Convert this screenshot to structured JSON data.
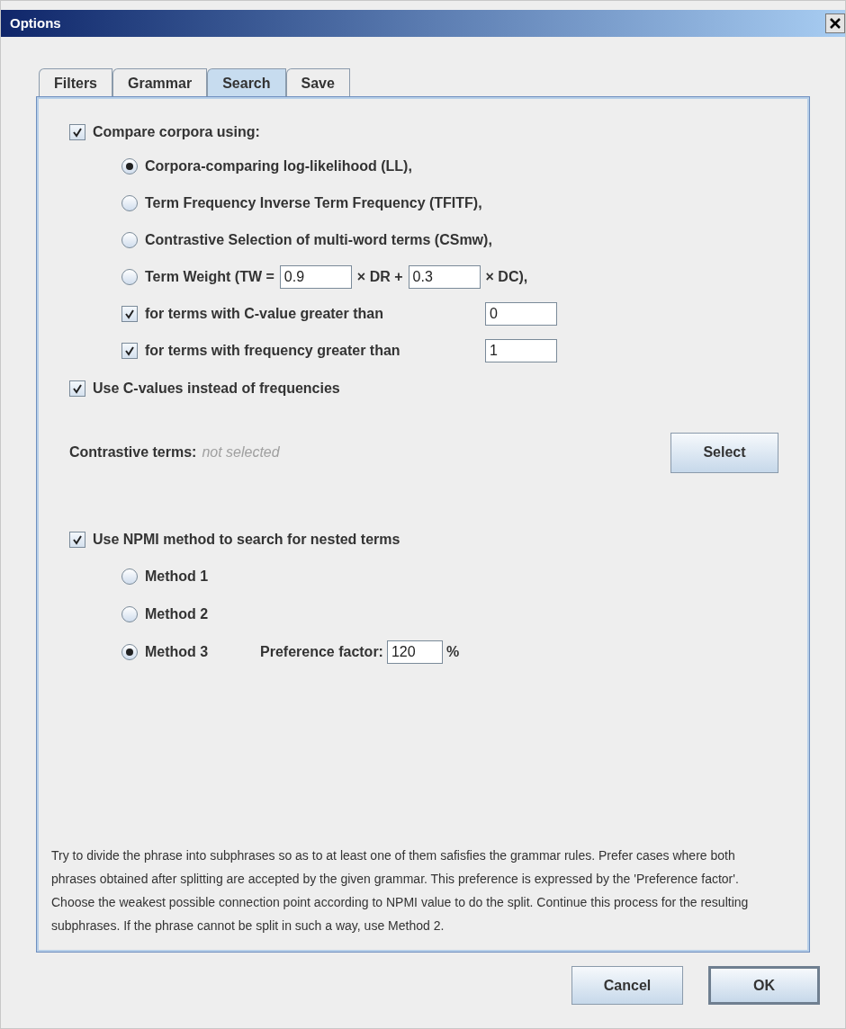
{
  "window": {
    "title": "Options"
  },
  "tabs": [
    {
      "label": "Filters",
      "selected": false
    },
    {
      "label": "Grammar",
      "selected": false
    },
    {
      "label": "Search",
      "selected": true
    },
    {
      "label": "Save",
      "selected": false
    }
  ],
  "compare_corpora": {
    "label": "Compare corpora using:",
    "checked": true,
    "methods": [
      {
        "kind": "plain",
        "label": "Corpora-comparing log-likelihood (LL),",
        "selected": true
      },
      {
        "kind": "plain",
        "label": "Term Frequency Inverse Term Frequency (TFITF),",
        "selected": false
      },
      {
        "kind": "plain",
        "label": "Contrastive Selection of multi-word terms (CSmw),",
        "selected": false
      },
      {
        "kind": "weight",
        "label": "Term Weight  (TW =",
        "dr_value": "0.9",
        "dr_label": "× DR +",
        "dc_value": "0.3",
        "dc_label": "× DC),",
        "selected": false
      }
    ],
    "thresholds": [
      {
        "label": "for terms with C-value greater than",
        "checked": true,
        "value": "0"
      },
      {
        "label": "for terms with frequency greater than",
        "checked": true,
        "value": "1"
      }
    ]
  },
  "use_c_values": {
    "label": "Use C-values instead of frequencies",
    "checked": true
  },
  "contrastive_terms": {
    "label": "Contrastive terms:",
    "value": "not selected",
    "button": "Select"
  },
  "npmi": {
    "label": "Use NPMI method to search for nested terms",
    "checked": true,
    "methods": [
      {
        "label": "Method 1",
        "selected": false
      },
      {
        "label": "Method 2",
        "selected": false
      },
      {
        "label": "Method 3",
        "selected": true,
        "preference_label": "Preference factor:",
        "preference_value": "120",
        "unit": "%"
      }
    ]
  },
  "description": "Try to divide the phrase into subphrases so as to at least one of them safisfies the grammar rules. Prefer cases where both phrases obtained after splitting are accepted by the given grammar. This preference is expressed by the 'Preference factor'. Choose the weakest possible connection point according to NPMI value to do the split. Continue this process for the resulting subphrases. If the phrase cannot be split in such a way, use Method 2.",
  "buttons": [
    {
      "label": "Cancel",
      "default": false
    },
    {
      "label": "OK",
      "default": true
    }
  ]
}
